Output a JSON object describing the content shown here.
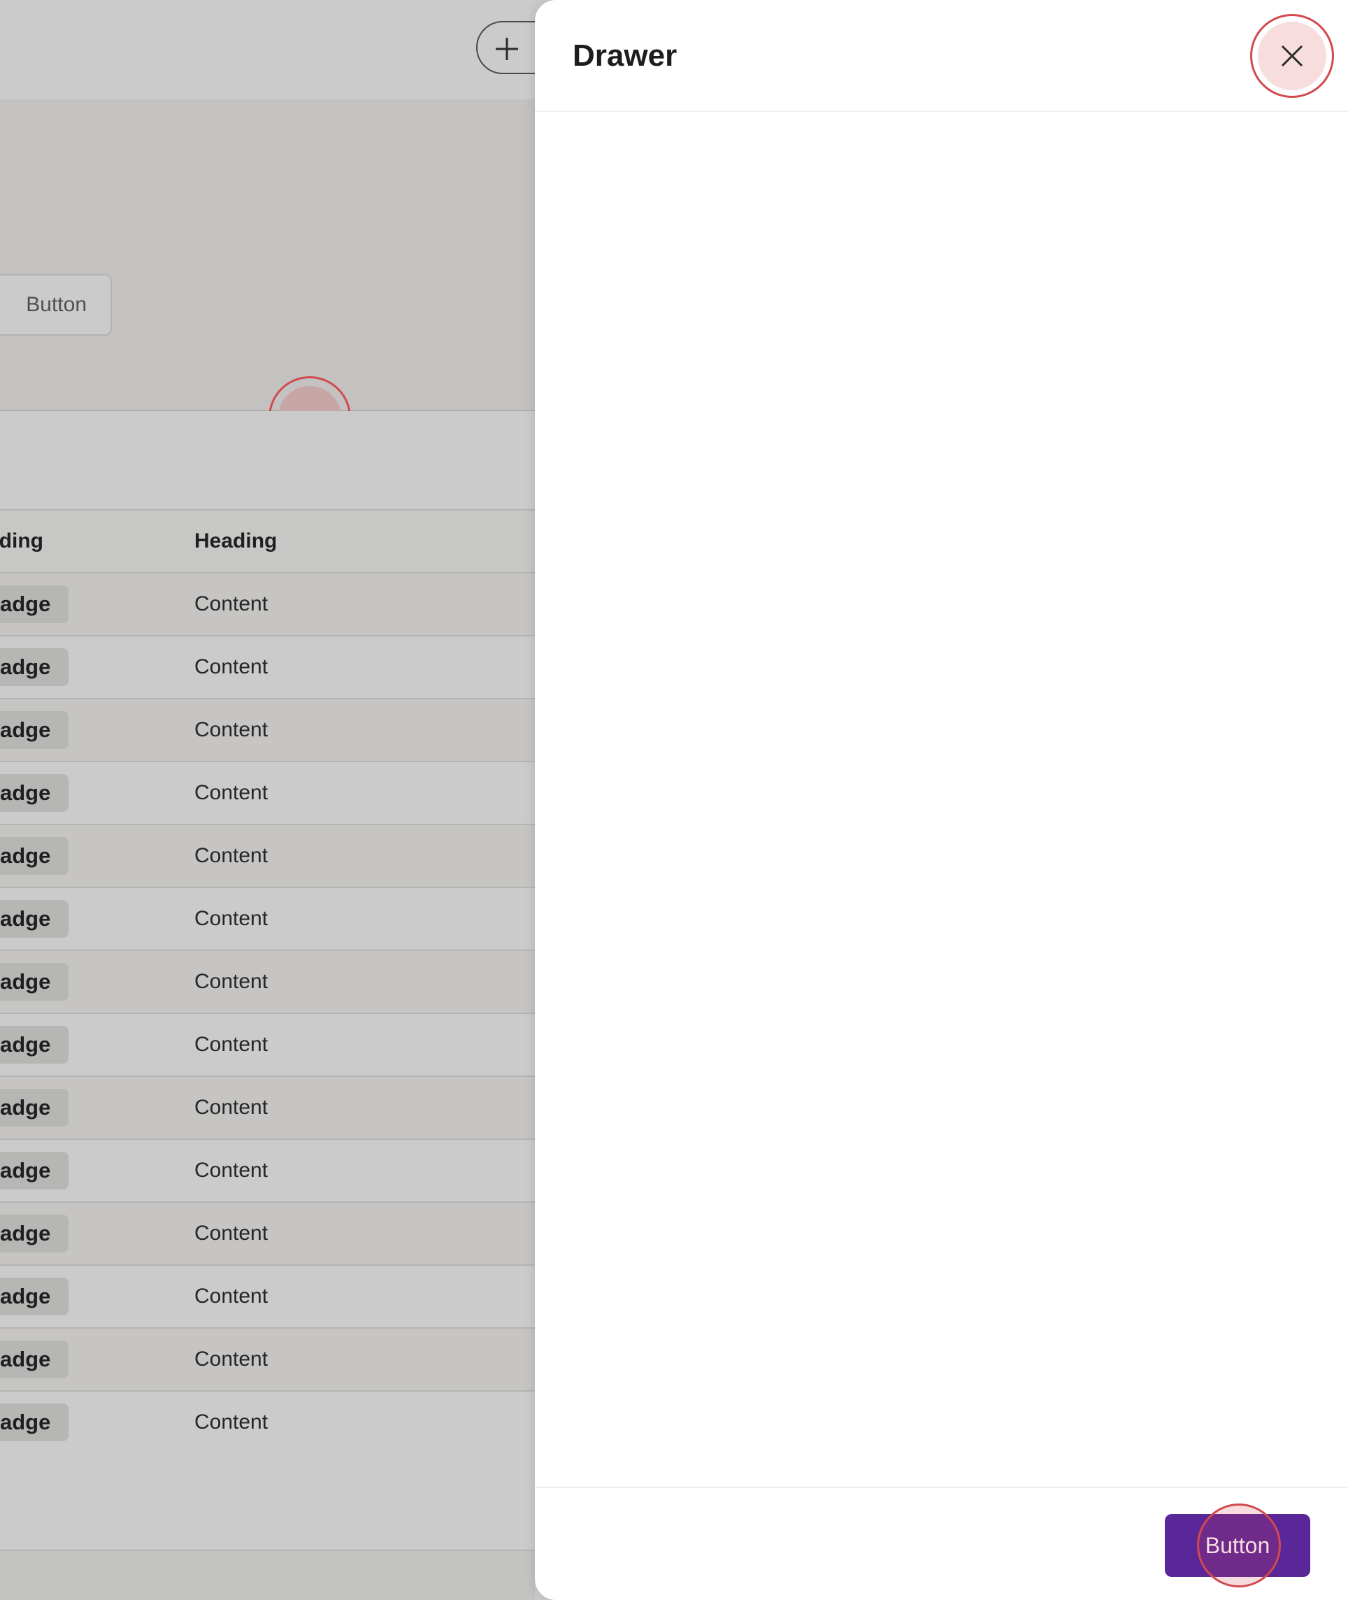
{
  "background": {
    "add_button_icon": "plus-icon",
    "hero_button_label": "Button",
    "table": {
      "headers": [
        "ading",
        "Heading"
      ],
      "rows": [
        {
          "badge": "adge",
          "content": "Content"
        },
        {
          "badge": "adge",
          "content": "Content"
        },
        {
          "badge": "adge",
          "content": "Content"
        },
        {
          "badge": "adge",
          "content": "Content"
        },
        {
          "badge": "adge",
          "content": "Content"
        },
        {
          "badge": "adge",
          "content": "Content"
        },
        {
          "badge": "adge",
          "content": "Content"
        },
        {
          "badge": "adge",
          "content": "Content"
        },
        {
          "badge": "adge",
          "content": "Content"
        },
        {
          "badge": "adge",
          "content": "Content"
        },
        {
          "badge": "adge",
          "content": "Content"
        },
        {
          "badge": "adge",
          "content": "Content"
        },
        {
          "badge": "adge",
          "content": "Content"
        },
        {
          "badge": "adge",
          "content": "Content"
        }
      ]
    }
  },
  "drawer": {
    "title": "Drawer",
    "close_icon": "close-icon",
    "footer_button_label": "Button"
  },
  "colors": {
    "accent": "#5a2798",
    "click_indicator": "#d24a4f",
    "overlay_dim": "#cbcbcb"
  }
}
